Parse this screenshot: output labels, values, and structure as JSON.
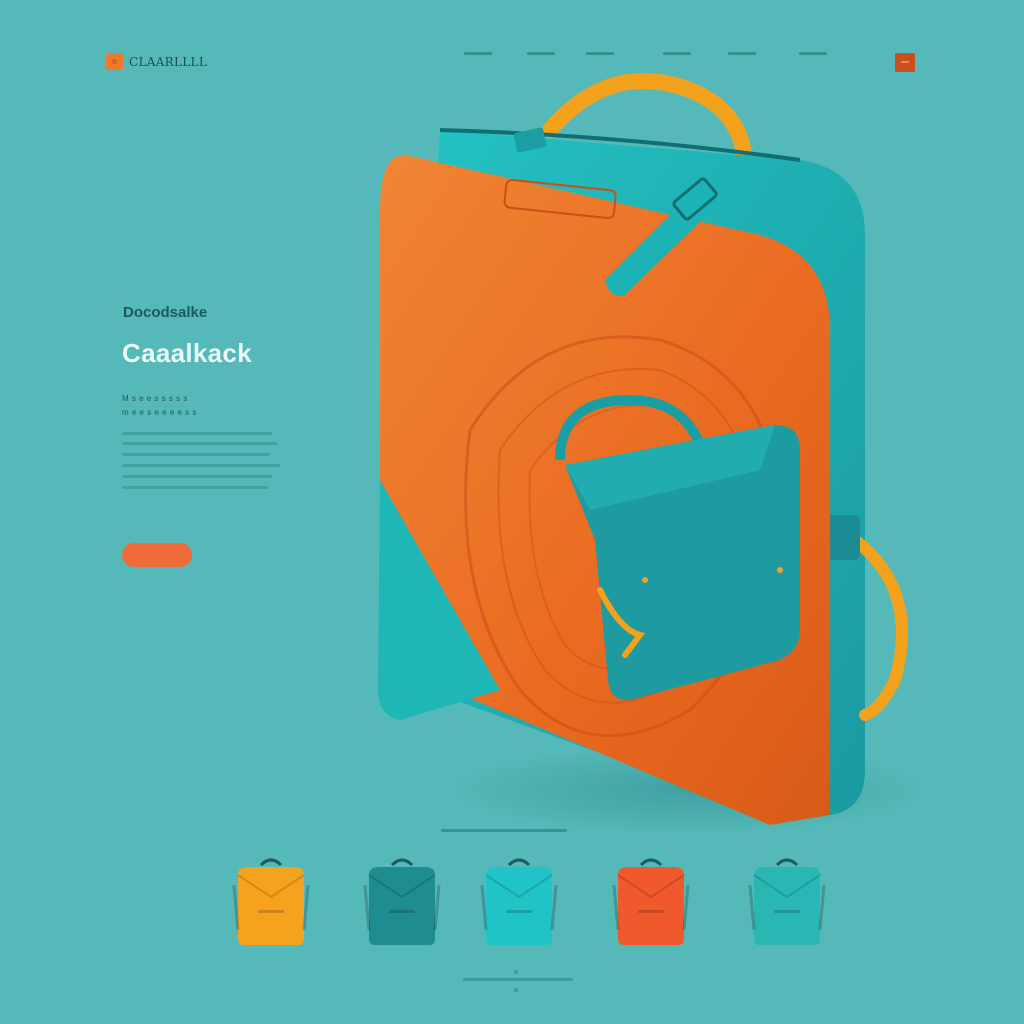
{
  "header": {
    "logo_text": "CLAARLLLL",
    "logo_icon": "logo-square-icon",
    "nav_links": [
      "",
      "",
      "",
      "",
      "",
      ""
    ],
    "cta_icon": "menu-icon"
  },
  "hero": {
    "eyebrow": "Docodsalke",
    "title": "Caaalkack",
    "subtitle_lines": [
      "M s  e e  s s s  s s",
      "m e e s e e e e s s"
    ],
    "shop_button_label": "",
    "image_alt_icon": "backpack-icon"
  },
  "products": {
    "caption": "",
    "items": [
      {
        "icon": "backpack-icon",
        "color": "#f5a31e"
      },
      {
        "icon": "backpack-icon",
        "color": "#1f8c8f"
      },
      {
        "icon": "backpack-icon",
        "color": "#21c4c6"
      },
      {
        "icon": "backpack-icon",
        "color": "#f0592c"
      },
      {
        "icon": "backpack-icon",
        "color": "#2ab7b4"
      }
    ]
  },
  "colors": {
    "background": "#54b9b8",
    "accent": "#ef6b37",
    "bag_orange": "#ef7a2a",
    "bag_teal": "#1bb2b5",
    "strap_yellow": "#f4a21b"
  }
}
